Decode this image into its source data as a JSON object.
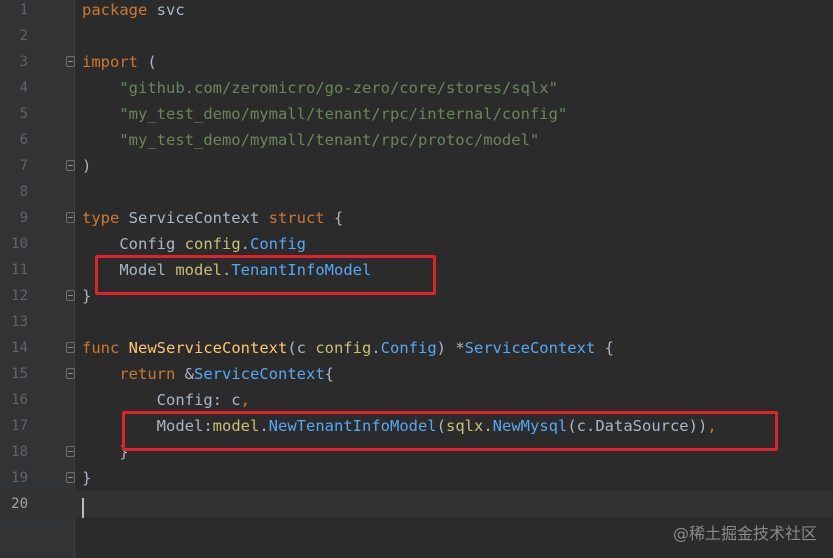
{
  "editor": {
    "lines": [
      {
        "num": "1",
        "tokens": [
          {
            "t": "package",
            "c": "kw"
          },
          {
            "t": " svc",
            "c": "txt"
          }
        ]
      },
      {
        "num": "2",
        "tokens": []
      },
      {
        "num": "3",
        "fold": true,
        "tokens": [
          {
            "t": "import",
            "c": "kw"
          },
          {
            "t": " (",
            "c": "txt"
          }
        ]
      },
      {
        "num": "4",
        "tokens": [
          {
            "t": "    \"github.com/zeromicro/go-zero/core/stores/sqlx\"",
            "c": "str"
          }
        ]
      },
      {
        "num": "5",
        "tokens": [
          {
            "t": "    \"my_test_demo/mymall/tenant/rpc/internal/config\"",
            "c": "str"
          }
        ]
      },
      {
        "num": "6",
        "tokens": [
          {
            "t": "    \"my_test_demo/mymall/tenant/rpc/protoc/model\"",
            "c": "str"
          }
        ]
      },
      {
        "num": "7",
        "fold": true,
        "tokens": [
          {
            "t": ")",
            "c": "txt"
          }
        ]
      },
      {
        "num": "8",
        "tokens": []
      },
      {
        "num": "9",
        "fold": true,
        "tokens": [
          {
            "t": "type",
            "c": "kw"
          },
          {
            "t": " ServiceContext ",
            "c": "txt"
          },
          {
            "t": "struct",
            "c": "kw"
          },
          {
            "t": " {",
            "c": "txt"
          }
        ]
      },
      {
        "num": "10",
        "tokens": [
          {
            "t": "    Config ",
            "c": "txt"
          },
          {
            "t": "config",
            "c": "pkg2"
          },
          {
            "t": ".",
            "c": "txt"
          },
          {
            "t": "Config",
            "c": "ty"
          }
        ]
      },
      {
        "num": "11",
        "tokens": [
          {
            "t": "    Model ",
            "c": "txt"
          },
          {
            "t": "model",
            "c": "pkg2"
          },
          {
            "t": ".",
            "c": "txt"
          },
          {
            "t": "TenantInfoModel",
            "c": "ty"
          }
        ]
      },
      {
        "num": "12",
        "fold": true,
        "tokens": [
          {
            "t": "}",
            "c": "txt"
          }
        ]
      },
      {
        "num": "13",
        "tokens": []
      },
      {
        "num": "14",
        "fold": true,
        "tokens": [
          {
            "t": "func",
            "c": "kw"
          },
          {
            "t": " ",
            "c": "txt"
          },
          {
            "t": "NewServiceContext",
            "c": "fn"
          },
          {
            "t": "(c ",
            "c": "txt"
          },
          {
            "t": "config",
            "c": "pkg2"
          },
          {
            "t": ".",
            "c": "txt"
          },
          {
            "t": "Config",
            "c": "ty"
          },
          {
            "t": ") *",
            "c": "txt"
          },
          {
            "t": "ServiceContext",
            "c": "ty"
          },
          {
            "t": " {",
            "c": "txt"
          }
        ]
      },
      {
        "num": "15",
        "fold": true,
        "tokens": [
          {
            "t": "    ",
            "c": "txt"
          },
          {
            "t": "return",
            "c": "kw"
          },
          {
            "t": " &",
            "c": "txt"
          },
          {
            "t": "ServiceContext",
            "c": "ty"
          },
          {
            "t": "{",
            "c": "txt"
          }
        ]
      },
      {
        "num": "16",
        "tokens": [
          {
            "t": "        Config: c",
            "c": "txt"
          },
          {
            "t": ",",
            "c": "kw"
          }
        ]
      },
      {
        "num": "17",
        "tokens": [
          {
            "t": "        Model:",
            "c": "txt"
          },
          {
            "t": "model",
            "c": "pkg2"
          },
          {
            "t": ".",
            "c": "txt"
          },
          {
            "t": "NewTenantInfoModel",
            "c": "ty"
          },
          {
            "t": "(",
            "c": "txt"
          },
          {
            "t": "sqlx",
            "c": "pkg2"
          },
          {
            "t": ".",
            "c": "txt"
          },
          {
            "t": "NewMysql",
            "c": "ty"
          },
          {
            "t": "(c.DataSource))",
            "c": "txt"
          },
          {
            "t": ",",
            "c": "kw"
          }
        ]
      },
      {
        "num": "18",
        "fold": true,
        "tokens": [
          {
            "t": "    }",
            "c": "txt"
          }
        ]
      },
      {
        "num": "19",
        "fold": true,
        "tokens": [
          {
            "t": "}",
            "c": "txt"
          }
        ]
      },
      {
        "num": "20",
        "current": true,
        "tokens": []
      }
    ]
  },
  "watermark": "@稀土掘金技术社区",
  "colors": {
    "background": "#2b2b2b",
    "keyword": "#cc7832",
    "string": "#6a8759",
    "function": "#ffc66d",
    "type": "#56a8f5",
    "highlight_box": "#e0232b"
  }
}
